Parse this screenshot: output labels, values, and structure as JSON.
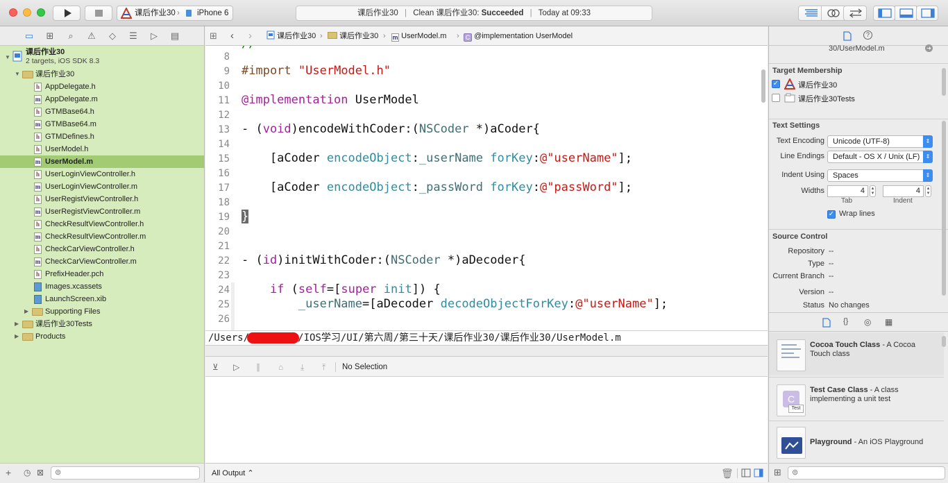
{
  "toolbar": {
    "scheme": "课后作业30",
    "destination": "iPhone 6",
    "status_project": "课后作业30",
    "status_prefix": "Clean 课后作业30:",
    "status_result": "Succeeded",
    "status_time": "Today at 09:33"
  },
  "navigator": {
    "project_name": "课后作业30",
    "project_sub": "2 targets, iOS SDK 8.3",
    "group_name": "课后作业30",
    "files": [
      {
        "name": "AppDelegate.h",
        "type": "h"
      },
      {
        "name": "AppDelegate.m",
        "type": "m"
      },
      {
        "name": "GTMBase64.h",
        "type": "h"
      },
      {
        "name": "GTMBase64.m",
        "type": "m"
      },
      {
        "name": "GTMDefines.h",
        "type": "h"
      },
      {
        "name": "UserModel.h",
        "type": "h"
      },
      {
        "name": "UserModel.m",
        "type": "m"
      },
      {
        "name": "UserLoginViewController.h",
        "type": "h"
      },
      {
        "name": "UserLoginViewController.m",
        "type": "m"
      },
      {
        "name": "UserRegistViewController.h",
        "type": "h"
      },
      {
        "name": "UserRegistViewController.m",
        "type": "m"
      },
      {
        "name": "CheckResultViewController.h",
        "type": "h"
      },
      {
        "name": "CheckResultViewController.m",
        "type": "m"
      },
      {
        "name": "CheckCarViewController.h",
        "type": "h"
      },
      {
        "name": "CheckCarViewController.m",
        "type": "m"
      },
      {
        "name": "PrefixHeader.pch",
        "type": "h"
      },
      {
        "name": "Images.xcassets",
        "type": "x"
      },
      {
        "name": "LaunchScreen.xib",
        "type": "x"
      }
    ],
    "supporting": "Supporting Files",
    "tests_group": "课后作业30Tests",
    "products": "Products"
  },
  "jumpbar": {
    "crumbs": [
      "课后作业30",
      "课后作业30",
      "UserModel.m",
      "@implementation UserModel"
    ]
  },
  "editor": {
    "line_numbers": [
      "8",
      "9",
      "10",
      "11",
      "12",
      "13",
      "14",
      "15",
      "16",
      "17",
      "18",
      "19",
      "20",
      "21",
      "22",
      "23",
      "24",
      "25",
      "26"
    ],
    "path": "/Users/        /360云盘/IOS学习/UI/第六周/第三十天/课后作业30/课后作业30/UserModel.m"
  },
  "debug": {
    "selection": "No Selection"
  },
  "console": {
    "output_label": "All Output ⌃"
  },
  "inspector": {
    "file_path_tail": "30/UserModel.m",
    "target_membership_title": "Target Membership",
    "targets": [
      {
        "name": "课后作业30",
        "checked": true
      },
      {
        "name": "课后作业30Tests",
        "checked": false
      }
    ],
    "text_settings_title": "Text Settings",
    "text_encoding_label": "Text Encoding",
    "text_encoding": "Unicode (UTF-8)",
    "line_endings_label": "Line Endings",
    "line_endings": "Default - OS X / Unix (LF)",
    "indent_using_label": "Indent Using",
    "indent_using": "Spaces",
    "widths_label": "Widths",
    "tab_width": "4",
    "indent_width": "4",
    "tab_label": "Tab",
    "indent_label": "Indent",
    "wrap_lines": "Wrap lines",
    "source_control_title": "Source Control",
    "repository_label": "Repository",
    "repository": "--",
    "type_label": "Type",
    "type": "--",
    "branch_label": "Current Branch",
    "branch": "--",
    "version_label": "Version",
    "version": "--",
    "status_label": "Status",
    "status": "No changes"
  },
  "library": {
    "items": [
      {
        "title": "Cocoa Touch Class",
        "desc": " - A Cocoa Touch class"
      },
      {
        "title": "Test Case Class",
        "desc": " - A class implementing a unit test"
      },
      {
        "title": "Playground",
        "desc": " - An iOS Playground"
      }
    ]
  }
}
